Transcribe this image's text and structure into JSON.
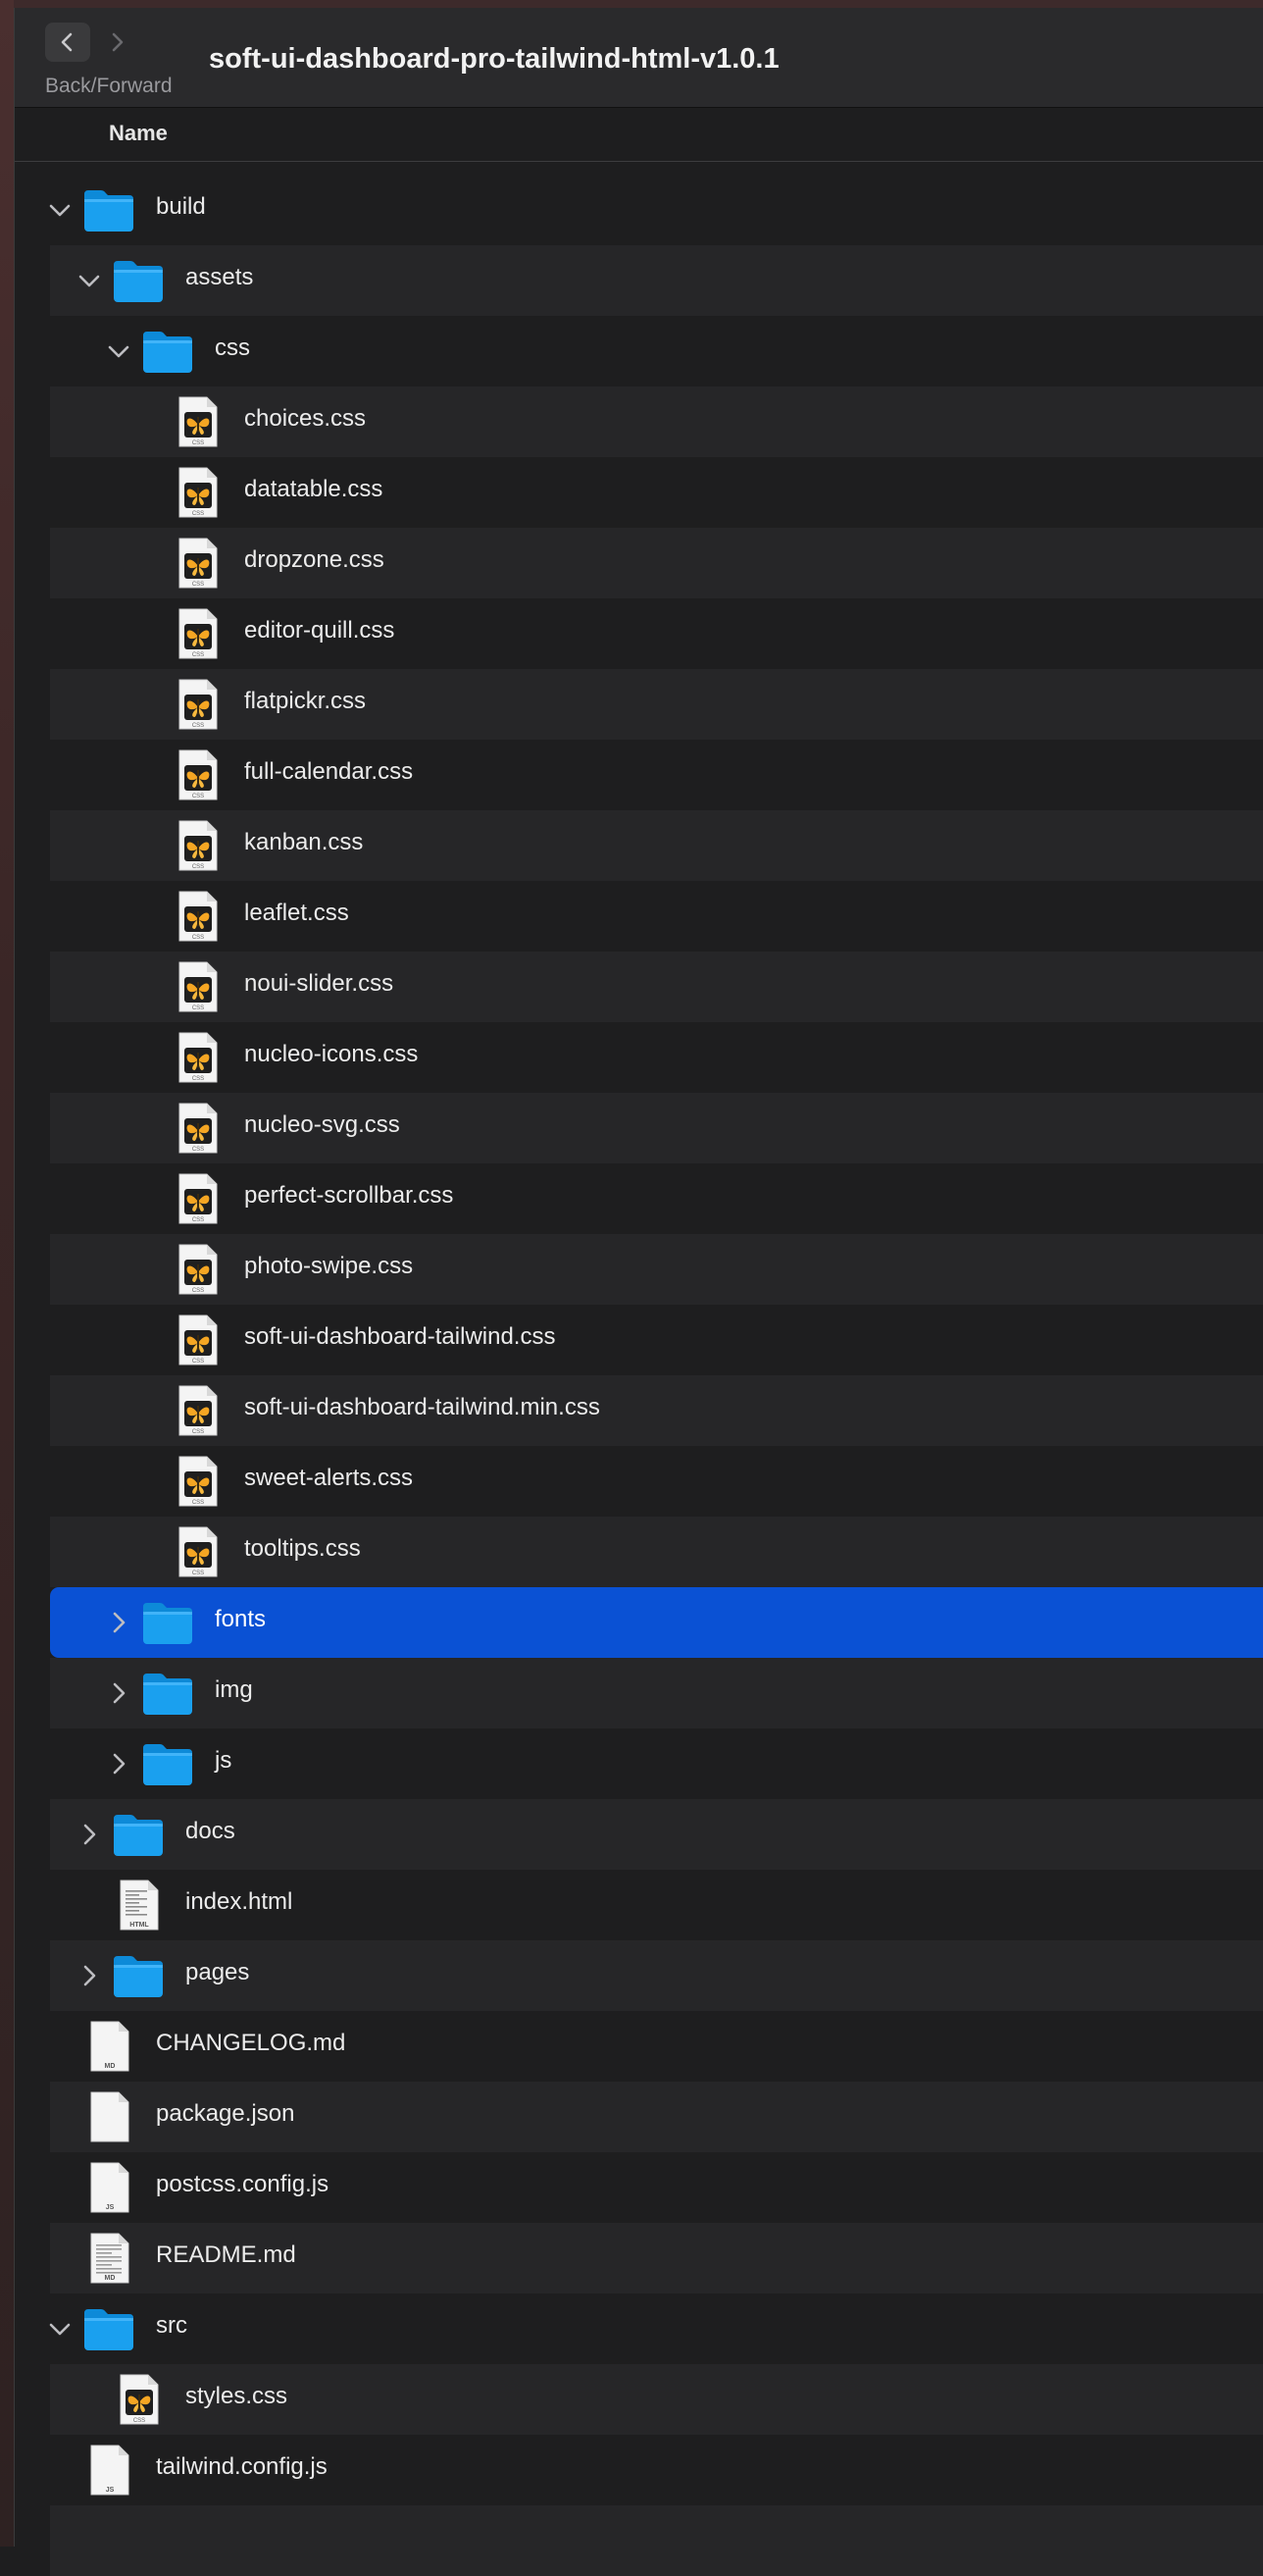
{
  "window": {
    "title": "soft-ui-dashboard-pro-tailwind-html-v1.0.1",
    "nav_label": "Back/Forward"
  },
  "columns": {
    "name": "Name"
  },
  "colors": {
    "selection": "#0a51d4",
    "folder": "#1aa0ef"
  },
  "rows": [
    {
      "name": "build",
      "kind": "folder",
      "depth": 0,
      "disclosure": "open"
    },
    {
      "name": "assets",
      "kind": "folder",
      "depth": 1,
      "disclosure": "open"
    },
    {
      "name": "css",
      "kind": "folder",
      "depth": 2,
      "disclosure": "open"
    },
    {
      "name": "choices.css",
      "kind": "css",
      "depth": 3
    },
    {
      "name": "datatable.css",
      "kind": "css",
      "depth": 3
    },
    {
      "name": "dropzone.css",
      "kind": "css",
      "depth": 3
    },
    {
      "name": "editor-quill.css",
      "kind": "css",
      "depth": 3
    },
    {
      "name": "flatpickr.css",
      "kind": "css",
      "depth": 3
    },
    {
      "name": "full-calendar.css",
      "kind": "css",
      "depth": 3
    },
    {
      "name": "kanban.css",
      "kind": "css",
      "depth": 3
    },
    {
      "name": "leaflet.css",
      "kind": "css",
      "depth": 3
    },
    {
      "name": "noui-slider.css",
      "kind": "css",
      "depth": 3
    },
    {
      "name": "nucleo-icons.css",
      "kind": "css",
      "depth": 3
    },
    {
      "name": "nucleo-svg.css",
      "kind": "css",
      "depth": 3
    },
    {
      "name": "perfect-scrollbar.css",
      "kind": "css",
      "depth": 3
    },
    {
      "name": "photo-swipe.css",
      "kind": "css",
      "depth": 3
    },
    {
      "name": "soft-ui-dashboard-tailwind.css",
      "kind": "css",
      "depth": 3
    },
    {
      "name": "soft-ui-dashboard-tailwind.min.css",
      "kind": "css",
      "depth": 3
    },
    {
      "name": "sweet-alerts.css",
      "kind": "css",
      "depth": 3
    },
    {
      "name": "tooltips.css",
      "kind": "css",
      "depth": 3
    },
    {
      "name": "fonts",
      "kind": "folder",
      "depth": 2,
      "disclosure": "closed",
      "selected": true
    },
    {
      "name": "img",
      "kind": "folder",
      "depth": 2,
      "disclosure": "closed"
    },
    {
      "name": "js",
      "kind": "folder",
      "depth": 2,
      "disclosure": "closed"
    },
    {
      "name": "docs",
      "kind": "folder",
      "depth": 1,
      "disclosure": "closed"
    },
    {
      "name": "index.html",
      "kind": "html",
      "depth": 1,
      "badge": "HTML"
    },
    {
      "name": "pages",
      "kind": "folder",
      "depth": 1,
      "disclosure": "closed"
    },
    {
      "name": "CHANGELOG.md",
      "kind": "doc",
      "depth": 0,
      "badge": "MD"
    },
    {
      "name": "package.json",
      "kind": "doc",
      "depth": 0,
      "badge": ""
    },
    {
      "name": "postcss.config.js",
      "kind": "doc",
      "depth": 0,
      "badge": "JS"
    },
    {
      "name": "README.md",
      "kind": "readme",
      "depth": 0,
      "badge": "MD"
    },
    {
      "name": "src",
      "kind": "folder",
      "depth": 0,
      "disclosure": "open"
    },
    {
      "name": "styles.css",
      "kind": "css",
      "depth": 1
    },
    {
      "name": "tailwind.config.js",
      "kind": "doc",
      "depth": 0,
      "badge": "JS"
    },
    {
      "name": "",
      "kind": "empty",
      "depth": 0
    }
  ]
}
